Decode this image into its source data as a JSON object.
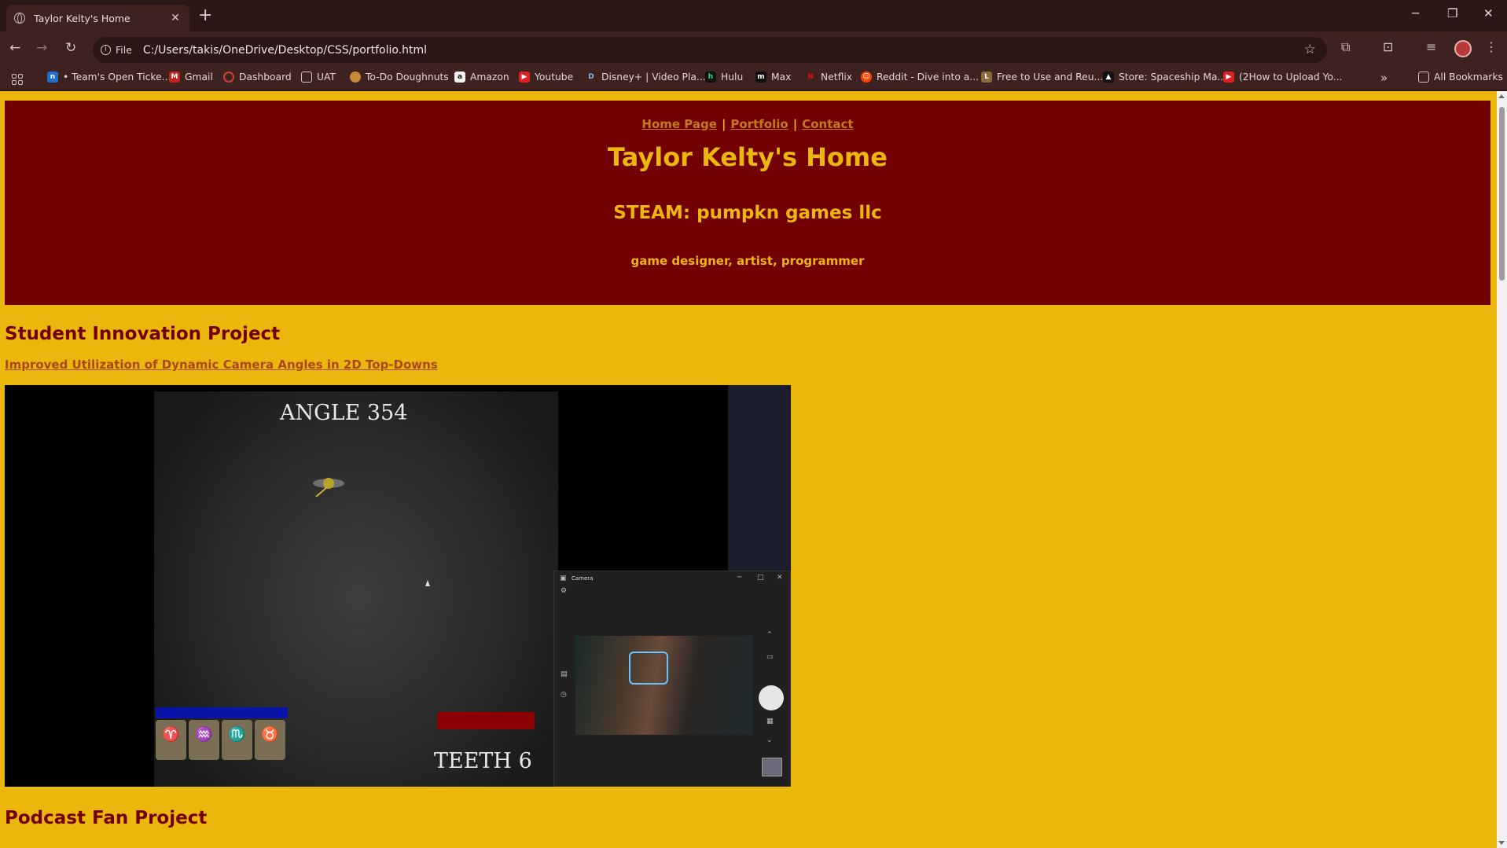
{
  "browser": {
    "tab_title": "Taylor Kelty's Home",
    "new_tab_symbol": "+",
    "close_symbol": "✕",
    "address_chip": "File",
    "url": "C:/Users/takis/OneDrive/Desktop/CSS/portfolio.html",
    "bookmarks": [
      {
        "label": "• Team's Open Ticke...",
        "icon": "notion-icon",
        "color": "#1f6fd1"
      },
      {
        "label": "Gmail",
        "icon": "gmail-icon",
        "color": "#c5221f"
      },
      {
        "label": "Dashboard",
        "icon": "dashboard-icon",
        "color": "#d04040"
      },
      {
        "label": "UAT",
        "icon": "folder-icon",
        "color": ""
      },
      {
        "label": "To-Do Doughnuts",
        "icon": "doughnut-icon",
        "color": "#c98a3a"
      },
      {
        "label": "Amazon",
        "icon": "amazon-icon",
        "color": "#222222"
      },
      {
        "label": "Youtube",
        "icon": "youtube-icon",
        "color": "#e02020"
      },
      {
        "label": "Disney+ | Video Pla...",
        "icon": "disney-icon",
        "color": "#1a3a8a"
      },
      {
        "label": "Hulu",
        "icon": "hulu-icon",
        "color": "#1a1a1a"
      },
      {
        "label": "Max",
        "icon": "max-icon",
        "color": "#1a1a1a"
      },
      {
        "label": "Netflix",
        "icon": "netflix-icon",
        "color": "#e50914"
      },
      {
        "label": "Reddit - Dive into a...",
        "icon": "reddit-icon",
        "color": "#ff4500"
      },
      {
        "label": "Free to Use and Reu...",
        "icon": "loc-icon",
        "color": "#8a6a3a"
      },
      {
        "label": "Store: Spaceship Ma...",
        "icon": "store-icon",
        "color": "#111111"
      },
      {
        "label": "(2How to Upload Yo...",
        "icon": "youtube-icon",
        "color": "#e02020"
      }
    ],
    "bookmarks_more": "»",
    "all_bookmarks": "All Bookmarks"
  },
  "site": {
    "nav": [
      "Home Page",
      "Portfolio",
      "Contact"
    ],
    "nav_sep": "|",
    "title": "Taylor Kelty's Home",
    "subtitle": "STEAM: pumpkn games llc",
    "roles": "game designer, artist, programmer"
  },
  "sections": {
    "innovation_heading": "Student Innovation Project",
    "innovation_link": "Improved Utilization of Dynamic Camera Angles in 2D Top-Downs",
    "podcast_heading": "Podcast Fan Project"
  },
  "video": {
    "angle_text": "ANGLE 354",
    "teeth_text": "TEETH 6",
    "slot_glyphs": [
      "♈",
      "♒",
      "♏",
      "♉"
    ],
    "camera_title": "Camera"
  },
  "colors": {
    "page_bg": "#ecb70d",
    "header_bg": "#720001",
    "accent_text": "#ecb70d",
    "heading_text": "#720001",
    "link_text": "#a8481a"
  }
}
